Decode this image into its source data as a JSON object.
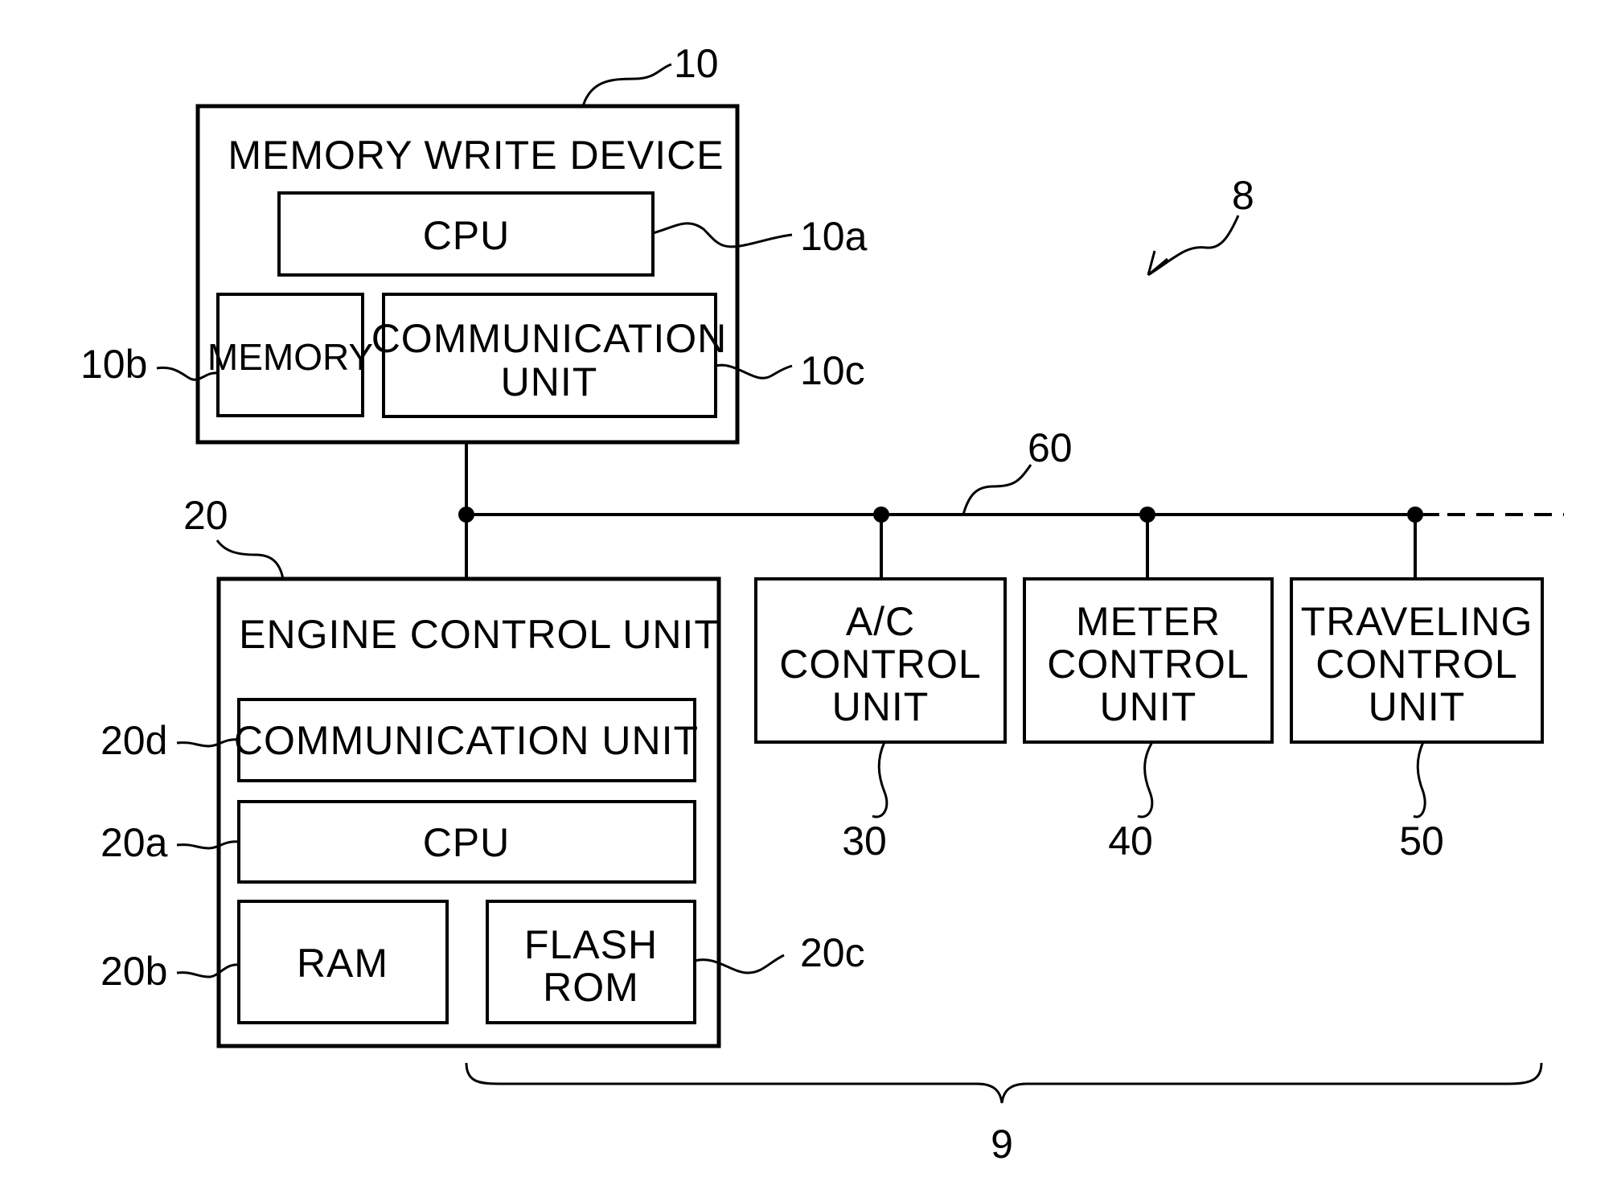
{
  "figure": {
    "system_ref": "8",
    "network_group_ref": "9",
    "bus_ref": "60"
  },
  "memory_write_device": {
    "ref": "10",
    "title": "MEMORY WRITE DEVICE",
    "cpu": {
      "ref": "10a",
      "label": "CPU"
    },
    "memory": {
      "ref": "10b",
      "label": "MEMORY"
    },
    "communication_unit": {
      "ref": "10c",
      "lines": [
        "COMMUNICATION",
        "UNIT"
      ]
    }
  },
  "engine_control_unit": {
    "ref": "20",
    "title": "ENGINE CONTROL UNIT",
    "communication_unit": {
      "ref": "20d",
      "label": "COMMUNICATION UNIT"
    },
    "cpu": {
      "ref": "20a",
      "label": "CPU"
    },
    "ram": {
      "ref": "20b",
      "label": "RAM"
    },
    "flash_rom": {
      "ref": "20c",
      "lines": [
        "FLASH",
        "ROM"
      ]
    }
  },
  "control_units": [
    {
      "ref": "30",
      "lines": [
        "A/C",
        "CONTROL",
        "UNIT"
      ]
    },
    {
      "ref": "40",
      "lines": [
        "METER",
        "CONTROL",
        "UNIT"
      ]
    },
    {
      "ref": "50",
      "lines": [
        "TRAVELING",
        "CONTROL",
        "UNIT"
      ]
    }
  ]
}
